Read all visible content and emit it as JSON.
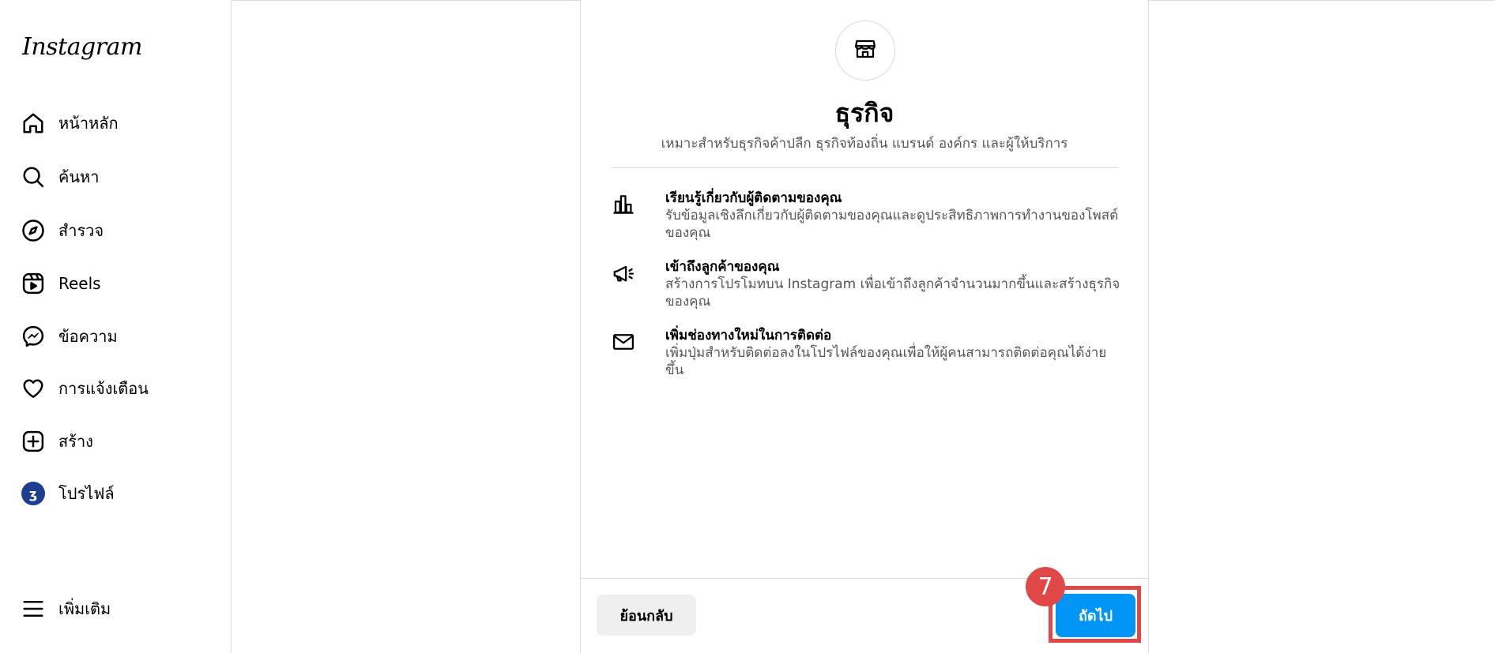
{
  "app": {
    "logo": "Instagram"
  },
  "sidebar": {
    "items": [
      {
        "label": "หน้าหลัก",
        "icon": "home-icon"
      },
      {
        "label": "ค้นหา",
        "icon": "search-icon"
      },
      {
        "label": "สำรวจ",
        "icon": "compass-icon"
      },
      {
        "label": "Reels",
        "icon": "reels-icon"
      },
      {
        "label": "ข้อความ",
        "icon": "messenger-icon"
      },
      {
        "label": "การแจ้งเตือน",
        "icon": "heart-icon"
      },
      {
        "label": "สร้าง",
        "icon": "plus-square-icon"
      },
      {
        "label": "โปรไฟล์",
        "icon": "avatar",
        "avatar_letter": "ʒ"
      }
    ],
    "more": {
      "label": "เพิ่มเติม",
      "icon": "menu-icon"
    }
  },
  "card": {
    "icon": "storefront-icon",
    "title": "ธุรกิจ",
    "subtitle": "เหมาะสำหรับธุรกิจค้าปลีก ธุรกิจท้องถิ่น แบรนด์ องค์กร และผู้ให้บริการ",
    "features": [
      {
        "icon": "bar-chart-icon",
        "heading": "เรียนรู้เกี่ยวกับผู้ติดตามของคุณ",
        "desc": "รับข้อมูลเชิงลึกเกี่ยวกับผู้ติดตามของคุณและดูประสิทธิภาพการทำงานของโพสต์ของคุณ"
      },
      {
        "icon": "megaphone-icon",
        "heading": "เข้าถึงลูกค้าของคุณ",
        "desc": "สร้างการโปรโมทบน Instagram เพื่อเข้าถึงลูกค้าจำนวนมากขึ้นและสร้างธุรกิจของคุณ"
      },
      {
        "icon": "mail-icon",
        "heading": "เพิ่มช่องทางใหม่ในการติดต่อ",
        "desc": "เพิ่มปุ่มสำหรับติดต่อลงในโปรไฟล์ของคุณเพื่อให้ผู้คนสามารถติดต่อคุณได้ง่ายขึ้น"
      }
    ],
    "back_label": "ย้อนกลับ",
    "next_label": "ถัดไป"
  },
  "annotation": {
    "step": "7",
    "color": "#e04848"
  },
  "colors": {
    "primary": "#0095f6",
    "border": "#dbdbdb"
  }
}
